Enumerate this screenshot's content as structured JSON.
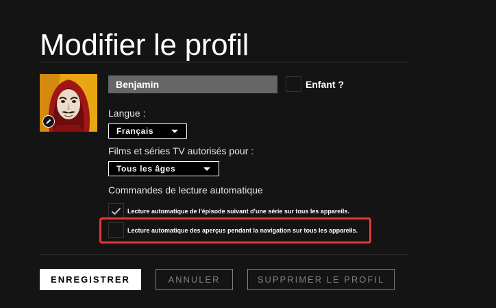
{
  "header": {
    "title": "Modifier le profil"
  },
  "profile": {
    "name_value": "Benjamin",
    "kids_label": "Enfant ?",
    "kids_checked": false,
    "avatar_icon": "money-heist-mask-avatar",
    "edit_icon": "pencil-icon"
  },
  "language": {
    "label": "Langue :",
    "selected": "Français"
  },
  "maturity": {
    "label": "Films et séries TV autorisés pour :",
    "selected": "Tous les âges"
  },
  "autoplay": {
    "heading": "Commandes de lecture automatique",
    "options": [
      {
        "label": "Lecture automatique de l'épisode suivant d'une série sur tous les appareils.",
        "checked": true
      },
      {
        "label": "Lecture automatique des aperçus pendant la navigation sur tous les appareils.",
        "checked": false
      }
    ],
    "highlight_color": "#e53935"
  },
  "actions": {
    "save_label": "ENREGISTRER",
    "cancel_label": "ANNULER",
    "delete_label": "SUPPRIMER LE PROFIL"
  }
}
